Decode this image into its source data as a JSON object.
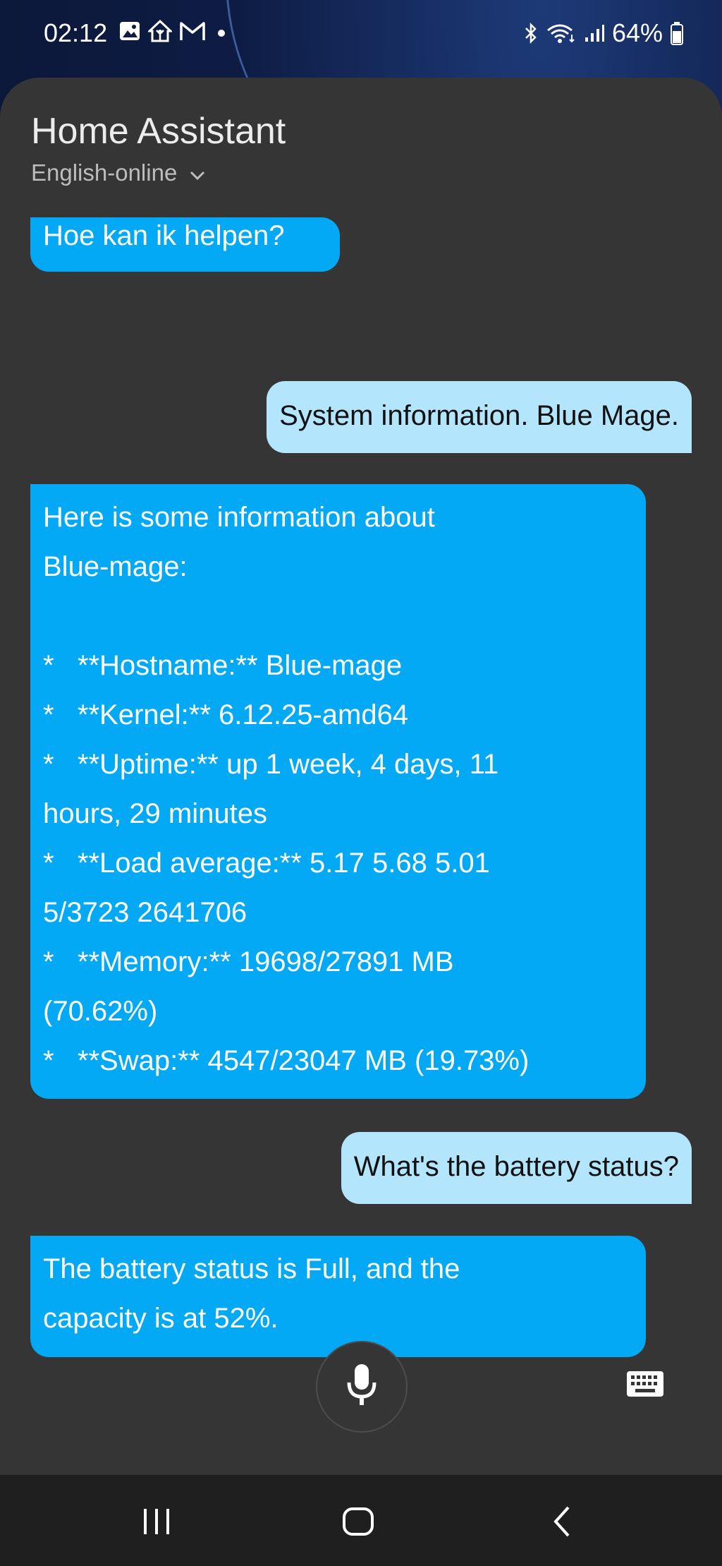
{
  "status_bar": {
    "time": "02:12",
    "battery": "64%",
    "left_icons": [
      "gallery-icon",
      "home-assistant-icon",
      "gmail-icon",
      "notification-dot-icon"
    ],
    "right_icons": [
      "bluetooth-icon",
      "wifi-icon",
      "signal-icon",
      "battery-icon"
    ]
  },
  "header": {
    "title": "Home Assistant",
    "language": "English-online"
  },
  "messages": [
    {
      "role": "assistant",
      "text": "Hoe kan ik helpen?"
    },
    {
      "role": "user",
      "text": "System information. Blue Mage."
    },
    {
      "role": "assistant",
      "text": "Here is some information about\nBlue-mage:\n\n*   **Hostname:** Blue-mage\n*   **Kernel:** 6.12.25-amd64\n*   **Uptime:** up 1 week, 4 days, 11\nhours, 29 minutes\n*   **Load average:** 5.17 5.68 5.01\n5/3723 2641706\n*   **Memory:** 19698/27891 MB\n(70.62%)\n*   **Swap:** 4547/23047 MB (19.73%)"
    },
    {
      "role": "user",
      "text": "What's the battery status?"
    },
    {
      "role": "assistant",
      "text": "The battery status is Full, and the\ncapacity is at 52%."
    }
  ],
  "colors": {
    "assistant_bubble": "#03a9f4",
    "user_bubble": "#b3e5fc",
    "sheet_background": "#353535"
  },
  "controls": {
    "mic_icon": "microphone-icon",
    "keyboard_icon": "keyboard-icon"
  },
  "nav": {
    "icons": [
      "recent-apps-icon",
      "home-icon",
      "back-icon"
    ]
  }
}
